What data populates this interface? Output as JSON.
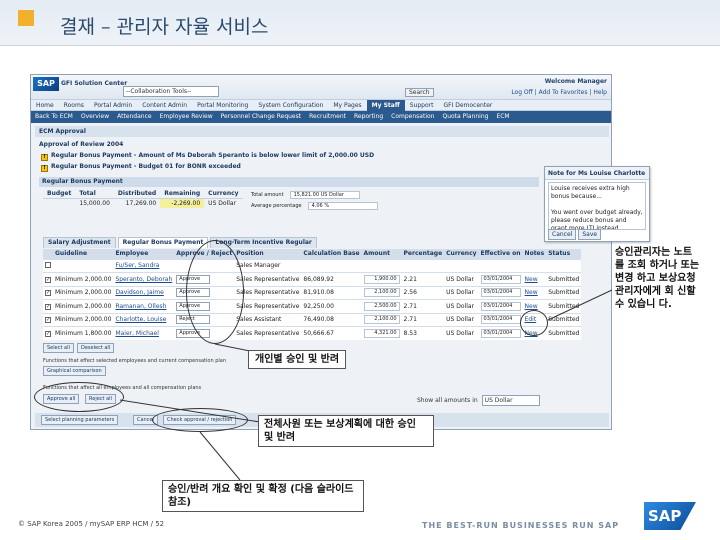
{
  "slide": {
    "title": "결재 – 관리자 자율 서비스",
    "footer_copyright": "© SAP Korea 2005 / mySAP ERP HCM / 52",
    "tagline": "THE BEST-RUN BUSINESSES RUN SAP",
    "logo_text": "SAP",
    "accent_color": "#f2b12d"
  },
  "portal": {
    "logo": "SAP",
    "name": "GFI Solution Center",
    "tools_select": "--Collaboration Tools--",
    "welcome": "Welcome Manager",
    "search_button": "Search",
    "top_links": "Log Off | Add To Favorites | Help",
    "nav1": [
      "Home",
      "Rooms",
      "Portal Admin",
      "Content Admin",
      "Portal Monitoring",
      "System Configuration",
      "My Pages",
      "My Staff",
      "Support",
      "GFI Democenter"
    ],
    "nav1_active": "My Staff",
    "nav2": [
      "Back To ECM",
      "Overview",
      "Attendance",
      "Employee Review",
      "Personnel Change Request",
      "Recruitment",
      "Reporting",
      "Compensation",
      "Quota Planning",
      "ECM"
    ]
  },
  "ecm": {
    "iview_title": "ECM Approval",
    "approval_title": "Approval of Review 2004",
    "warnings": [
      "Regular Bonus Payment - Amount of Ms Deborah Speranto is below lower limit of 2,000.00 USD",
      "Regular Bonus Payment - Budget 01 for BONR exceeded"
    ],
    "section_title": "Regular Bonus Payment",
    "budget": {
      "headers": [
        "Budget",
        "Total",
        "Distributed",
        "Remaining",
        "Currency"
      ],
      "row": [
        "",
        "15,000.00",
        "17,269.00",
        "-2,269.00",
        "US Dollar"
      ]
    },
    "totals": [
      {
        "label": "Total amount",
        "value": "15,821.00 US Dollar"
      },
      {
        "label": "Average percentage",
        "value": "4.06 %"
      }
    ],
    "tabs": [
      "Salary Adjustment",
      "Regular Bonus Payment",
      "Long-Term Incentive Regular"
    ],
    "active_tab": "Regular Bonus Payment",
    "table": {
      "headers": [
        "",
        "Guideline",
        "Employee",
        "Approve / Reject",
        "Position",
        "Calculation Base",
        "Amount",
        "Percentage",
        "Currency",
        "Effective on",
        "Notes",
        "Status"
      ],
      "rows": [
        {
          "guideline": "",
          "employee": "Fu/Ser, Sandra",
          "action": "",
          "position": "Sales Manager",
          "base": "",
          "amount": "",
          "pct": "",
          "currency": "",
          "date": "",
          "notes": "",
          "status": ""
        },
        {
          "guideline": "Minimum 2,000.00",
          "employee": "Speranto, Deborah",
          "action": "Approve",
          "position": "Sales Representative",
          "base": "86,089.92",
          "amount": "1,900.00",
          "pct": "2.21",
          "currency": "US Dollar",
          "date": "03/01/2004",
          "notes": "New",
          "status": "Submitted"
        },
        {
          "guideline": "Minimum 2,000.00",
          "employee": "Davidson, Jaime",
          "action": "Approve",
          "position": "Sales Representative",
          "base": "81,910.08",
          "amount": "2,100.00",
          "pct": "2.56",
          "currency": "US Dollar",
          "date": "03/01/2004",
          "notes": "New",
          "status": "Submitted"
        },
        {
          "guideline": "Minimum 2,000.00",
          "employee": "Ramanan, Ollesh",
          "action": "Approve",
          "position": "Sales Representative",
          "base": "92,250.00",
          "amount": "2,500.00",
          "pct": "2.71",
          "currency": "US Dollar",
          "date": "03/01/2004",
          "notes": "New",
          "status": "Submitted"
        },
        {
          "guideline": "Minimum 2,000.00",
          "employee": "Charlotte, Louise",
          "action": "Reject",
          "position": "Sales Assistant",
          "base": "76,490.08",
          "amount": "2,100.00",
          "pct": "2.71",
          "currency": "US Dollar",
          "date": "03/01/2004",
          "notes": "Edit",
          "status": "Submitted"
        },
        {
          "guideline": "Minimum 1,800.00",
          "employee": "Maier, Michael",
          "action": "Approve",
          "position": "Sales Representative",
          "base": "50,666.67",
          "amount": "4,321.00",
          "pct": "8.53",
          "currency": "US Dollar",
          "date": "03/01/2004",
          "notes": "New",
          "status": "Submitted"
        }
      ]
    },
    "select_all": "Select all",
    "deselect_all": "Deselect all",
    "func_text_1": "Functions that effect selected employees and current compensation plan",
    "graphical_comparison": "Graphical comparison",
    "func_text_2": "Functions that affect all employees and all compensation plans",
    "approve_all": "Approve all",
    "reject_all": "Reject all",
    "show_amounts_label": "Show all amounts in",
    "show_amounts_value": "US Dollar",
    "select_planning": "Select planning parameters",
    "cancel": "Cancel",
    "check_approval": "Check approval / rejection"
  },
  "note": {
    "title": "Note for Ms Louise Charlotte",
    "text": "Louise receives extra high bonus because...\n\nYou went over budget already, please reduce bonus and grant more LTI instead",
    "cancel": "Cancel",
    "save": "Save"
  },
  "callouts": {
    "right": "승인관리자는 노트를 조회 하거나 또는 변경 하고 보상요청 관리자에게 회 신할 수 있습니 다.",
    "individual": "개인별 승인 및 반려",
    "all": "전체사원 또는 보상계획에 대한 승인 및 반려",
    "confirm": "승인/반려 개요 확인 및 확정 (다음 슬라이드 참조)"
  }
}
